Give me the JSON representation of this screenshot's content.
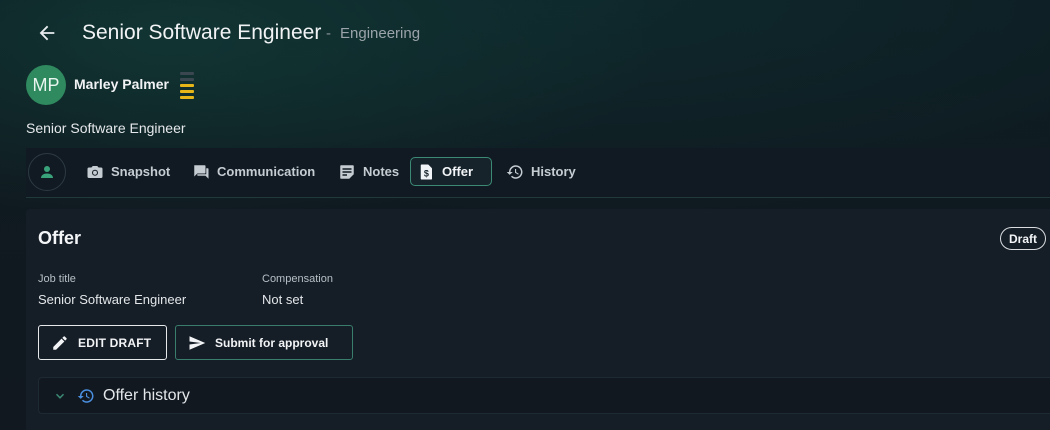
{
  "header": {
    "title": "Senior Software Engineer",
    "separator": "-",
    "department": "Engineering"
  },
  "candidate": {
    "initials": "MP",
    "name": "Marley Palmer",
    "avatar_color": "#2f8a5f",
    "rating_active_color": "#e6b619",
    "rating": {
      "filled": 3,
      "total": 5
    },
    "role": "Senior Software Engineer"
  },
  "tabs": [
    {
      "label": "Snapshot",
      "icon": "camera-icon"
    },
    {
      "label": "Communication",
      "icon": "chat-icon"
    },
    {
      "label": "Notes",
      "icon": "notes-icon"
    },
    {
      "label": "Offer",
      "icon": "offer-document-icon",
      "active": true
    },
    {
      "label": "History",
      "icon": "history-icon"
    }
  ],
  "offer": {
    "title": "Offer",
    "status": "Draft",
    "fields": [
      {
        "label": "Job title",
        "value": "Senior Software Engineer"
      },
      {
        "label": "Compensation",
        "value": "Not set"
      }
    ],
    "edit_button": "EDIT DRAFT",
    "submit_button": "Submit for approval",
    "history_label": "Offer history"
  },
  "colors": {
    "accent": "#3c8a75",
    "history_icon": "#4a8fe0"
  }
}
